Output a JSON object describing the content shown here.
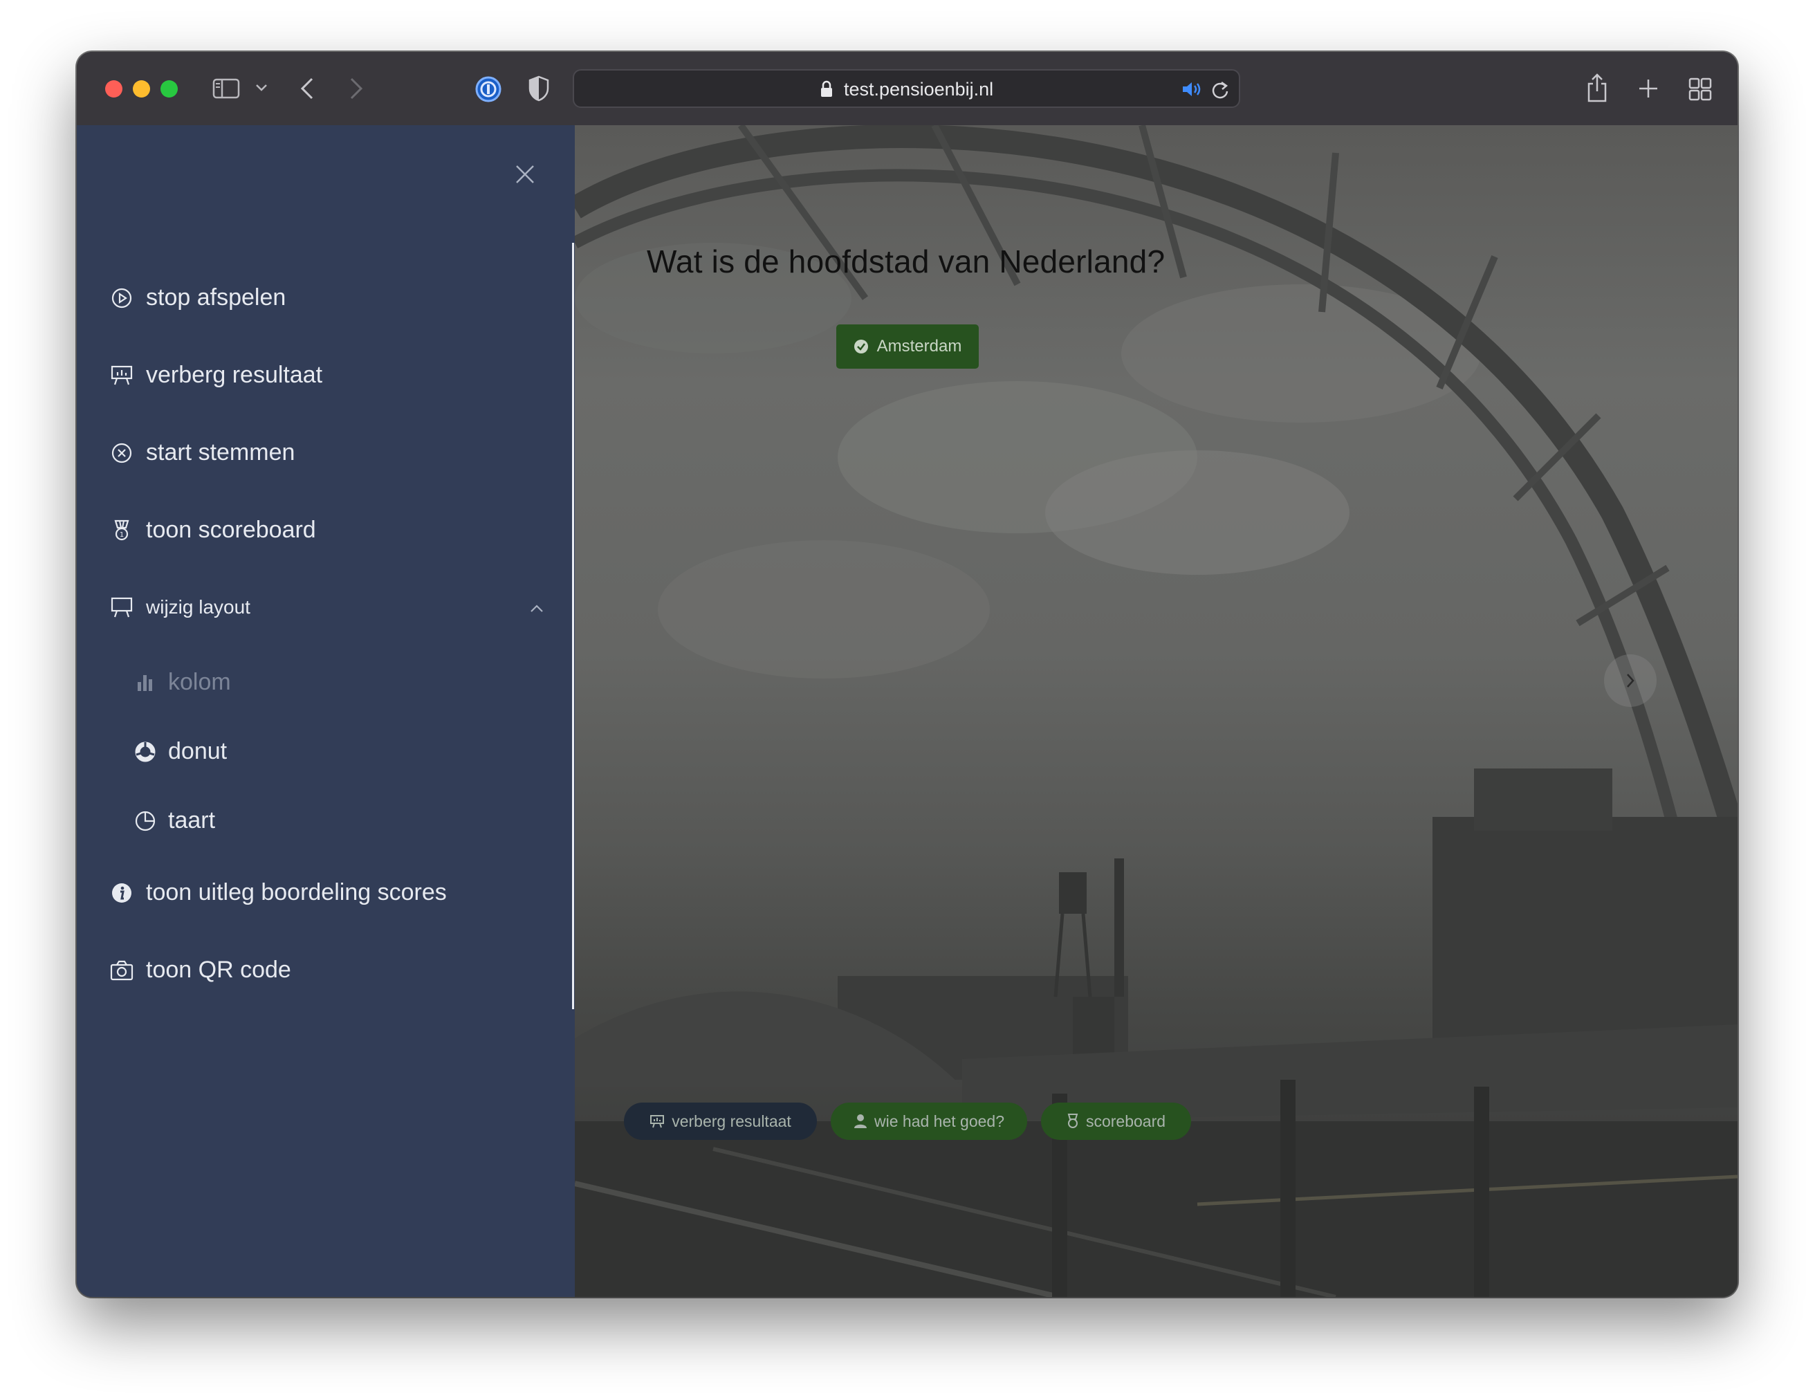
{
  "browser": {
    "url": "test.pensioenbij.nl"
  },
  "sidebar": {
    "items": [
      {
        "label": "stop afspelen",
        "icon": "play-circle-icon"
      },
      {
        "label": "verberg resultaat",
        "icon": "presentation-chart-icon"
      },
      {
        "label": "start stemmen",
        "icon": "x-circle-icon"
      },
      {
        "label": "toon scoreboard",
        "icon": "medal-icon"
      },
      {
        "label": "wijzig layout",
        "icon": "presentation-board-icon",
        "expanded": true
      },
      {
        "label": "toon uitleg boordeling scores",
        "icon": "info-icon"
      },
      {
        "label": "toon QR code",
        "icon": "camera-icon"
      }
    ],
    "layout_options": [
      {
        "label": "kolom",
        "icon": "bar-chart-icon",
        "active": true
      },
      {
        "label": "donut",
        "icon": "donut-icon"
      },
      {
        "label": "taart",
        "icon": "pie-chart-icon"
      }
    ]
  },
  "main": {
    "question": "Wat is de hoofdstad van Nederland?",
    "answer": "Amsterdam",
    "actions": [
      {
        "label": "verberg resultaat",
        "icon": "presentation-chart-icon"
      },
      {
        "label": "wie had het goed?",
        "icon": "user-icon"
      },
      {
        "label": "scoreboard",
        "icon": "medal-icon"
      }
    ]
  },
  "colors": {
    "sidebar_bg": "#323d57",
    "accent_green": "#27521f",
    "dark_pill": "#202a38"
  }
}
